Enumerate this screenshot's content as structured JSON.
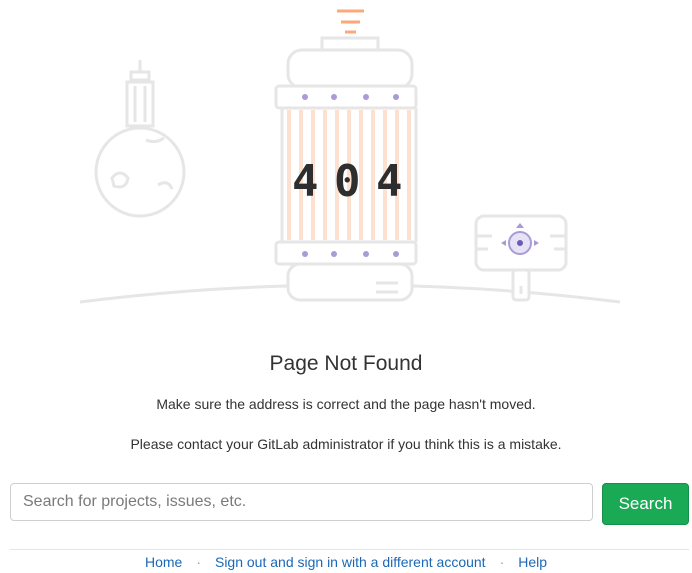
{
  "error": {
    "code_digits": [
      "4",
      "0",
      "4"
    ],
    "title": "Page Not Found",
    "message_1": "Make sure the address is correct and the page hasn't moved.",
    "message_2": "Please contact your GitLab administrator if you think this is a mistake."
  },
  "search": {
    "placeholder": "Search for projects, issues, etc.",
    "value": "",
    "button_label": "Search"
  },
  "footer": {
    "links": [
      {
        "label": "Home"
      },
      {
        "label": "Sign out and sign in with a different account"
      },
      {
        "label": "Help"
      }
    ],
    "separator": "·"
  },
  "colors": {
    "accent_green": "#1aaa55",
    "link_blue": "#1b69b6",
    "illustration_purple": "#a89bd6",
    "illustration_orange": "#fca97a",
    "illustration_gray": "#e3e3e3"
  }
}
